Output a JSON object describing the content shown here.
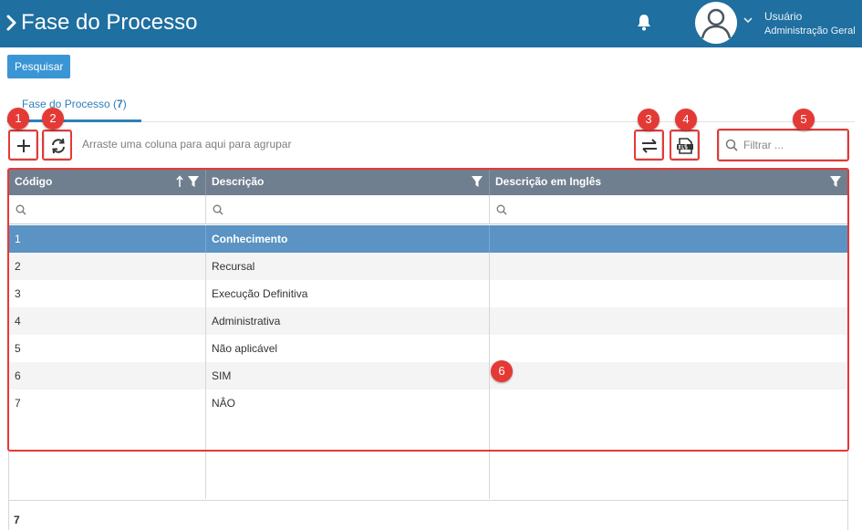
{
  "header": {
    "title": "Fase do Processo",
    "user_name": "Usuário",
    "user_role": "Administração Geral"
  },
  "actions": {
    "search_label": "Pesquisar"
  },
  "tab": {
    "label": "Fase do Processo (",
    "count": "7",
    "close": ")"
  },
  "toolbar": {
    "group_hint": "Arraste uma coluna para aqui para agrupar",
    "filter_placeholder": "Filtrar ..."
  },
  "grid": {
    "columns": [
      "Código",
      "Descrição",
      "Descrição em Inglês"
    ],
    "rows": [
      {
        "code": "1",
        "desc": "Conhecimento",
        "desc_en": ""
      },
      {
        "code": "2",
        "desc": "Recursal",
        "desc_en": ""
      },
      {
        "code": "3",
        "desc": "Execução Definitiva",
        "desc_en": ""
      },
      {
        "code": "4",
        "desc": "Administrativa",
        "desc_en": ""
      },
      {
        "code": "5",
        "desc": "Não aplicável",
        "desc_en": ""
      },
      {
        "code": "6",
        "desc": "SIM",
        "desc_en": ""
      },
      {
        "code": "7",
        "desc": "NÂO",
        "desc_en": ""
      }
    ],
    "selected_row": 0,
    "total": "7"
  },
  "markers": [
    "1",
    "2",
    "3",
    "4",
    "5",
    "6"
  ],
  "colors": {
    "header_bg": "#1f6fa0",
    "accent": "#3a95d5",
    "selection": "#5a93c4",
    "marker": "#e53935"
  },
  "icons": [
    "chevron-right-icon",
    "bell-icon",
    "user-avatar-icon",
    "plus-icon",
    "refresh-icon",
    "swap-icon",
    "xls-export-icon",
    "search-icon",
    "filter-icon",
    "sort-icon"
  ]
}
